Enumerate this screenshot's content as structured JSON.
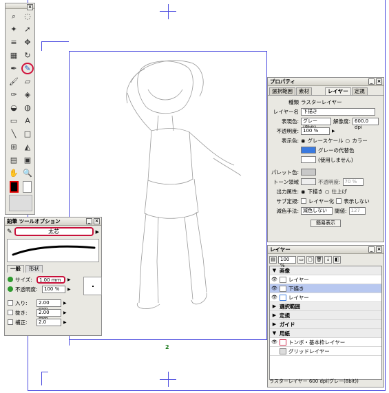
{
  "canvas": {
    "page_number": "2"
  },
  "tool_palette": {
    "tools": [
      {
        "name": "zoom-tool-icon",
        "glyph": "⌕"
      },
      {
        "name": "lasso-tool-icon",
        "glyph": "◌"
      },
      {
        "name": "magic-wand-icon",
        "glyph": "✦"
      },
      {
        "name": "object-select-icon",
        "glyph": "➚"
      },
      {
        "name": "hatch-tool-icon",
        "glyph": "≡"
      },
      {
        "name": "move-tool-icon",
        "glyph": "✥"
      },
      {
        "name": "grid-tool-icon",
        "glyph": "▦"
      },
      {
        "name": "rotate-tool-icon",
        "glyph": "↻"
      },
      {
        "name": "pen-tool-icon",
        "glyph": "✒"
      },
      {
        "name": "pencil-tool-icon",
        "glyph": "✎"
      },
      {
        "name": "brush-tool-icon",
        "glyph": "🖌"
      },
      {
        "name": "eraser-tool-icon",
        "glyph": "▱"
      },
      {
        "name": "ink-tool-icon",
        "glyph": "✑"
      },
      {
        "name": "fill-tool-icon",
        "glyph": "◈"
      },
      {
        "name": "bucket-tool-icon",
        "glyph": "◒"
      },
      {
        "name": "dodge-tool-icon",
        "glyph": "◍"
      },
      {
        "name": "gradient-tool-icon",
        "glyph": "▭"
      },
      {
        "name": "text-tool-icon",
        "glyph": "A"
      },
      {
        "name": "line-tool-icon",
        "glyph": "╲"
      },
      {
        "name": "rect-tool-icon",
        "glyph": "□"
      },
      {
        "name": "ruler-tool-icon",
        "glyph": "⊞"
      },
      {
        "name": "tone-tool-icon",
        "glyph": "◭"
      },
      {
        "name": "panel-tool-icon",
        "glyph": "▤"
      },
      {
        "name": "balloon-tool-icon",
        "glyph": "▣"
      },
      {
        "name": "hand-tool-icon",
        "glyph": "✋"
      },
      {
        "name": "loupe-tool-icon",
        "glyph": "🔍"
      }
    ]
  },
  "tool_options": {
    "title": "鉛筆 ツールオプション",
    "subtool": "太芯",
    "tabs": [
      "一般",
      "形状"
    ],
    "size_label": "サイズ:",
    "size_value": "1.00 mm",
    "opacity_label": "不透明度:",
    "opacity_value": "100 %",
    "in_label": "入り:",
    "in_value": "2.00 mm",
    "out_label": "抜き:",
    "out_value": "2.00 mm",
    "correction_label": "補正:",
    "correction_value": "2.0"
  },
  "properties": {
    "title": "プロパティ",
    "tabs": [
      "選択範囲",
      "素材",
      "レイヤー",
      "定規"
    ],
    "type_label": "種類",
    "type_value": "ラスターレイヤー",
    "layer_name_label": "レイヤー名",
    "layer_name_value": "下描き",
    "display_color_label": "表現色:",
    "display_color_value": "グレー(8bit)",
    "resolution_label": "解像度:",
    "resolution_value": "600.0 dpi",
    "opacity_label": "不透明度:",
    "opacity_value": "100 %",
    "display_label": "表示色:",
    "grayscale": "グレースケール",
    "color": "カラー",
    "gray_substitute": "グレーの代替色",
    "unused": "(使用しません)",
    "palette_label": "パレット色:",
    "tone_label": "トーン領域",
    "tone_opacity_label": "不透明度:",
    "tone_opacity_value": "70 %",
    "output_label": "出力属性:",
    "output_draft": "下描き",
    "output_finish": "仕上げ",
    "sub_ruler_label": "サブ定規:",
    "layerize": "レイヤー化",
    "show": "表示しない",
    "subtract_label": "減色手法:",
    "subtract_value": "減色しない",
    "threshold_label": "閾値:",
    "threshold_value": "127",
    "simple_display": "簡易表示",
    "accent_color": "#3a7ae0"
  },
  "layers": {
    "title": "レイヤー",
    "zoom": "100 %",
    "rows": [
      {
        "label": "画像",
        "type": "folder"
      },
      {
        "label": "レイヤー",
        "type": "layer"
      },
      {
        "label": "下描き",
        "type": "layer",
        "selected": true
      },
      {
        "label": "レイヤー",
        "type": "layer"
      },
      {
        "label": "選択範囲",
        "type": "folder"
      },
      {
        "label": "定規",
        "type": "folder"
      },
      {
        "label": "ガイド",
        "type": "folder"
      },
      {
        "label": "用紙",
        "type": "folder"
      },
      {
        "label": "トンボ・基本枠レイヤー",
        "type": "layer"
      },
      {
        "label": "グリッドレイヤー",
        "type": "layer"
      }
    ],
    "status": "ラスターレイヤー 600 dpi(グレー(8bit))"
  }
}
